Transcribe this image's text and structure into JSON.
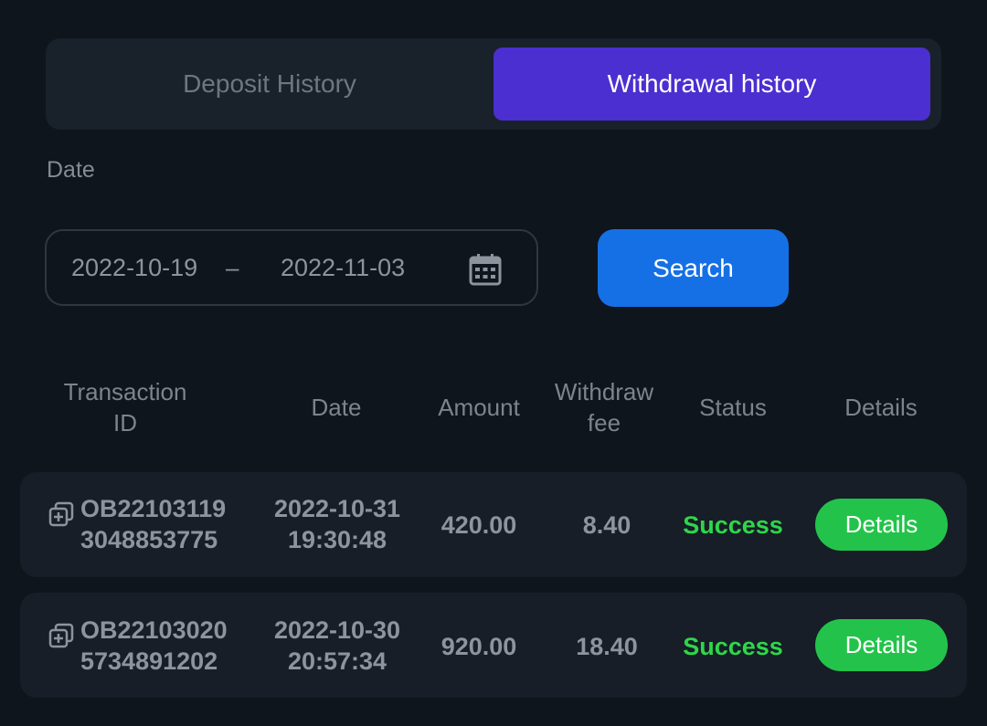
{
  "tabs": {
    "deposit_label": "Deposit History",
    "withdrawal_label": "Withdrawal history",
    "active": "withdrawal"
  },
  "filter": {
    "date_label": "Date",
    "date_from": "2022-10-19",
    "separator": "–",
    "date_to": "2022-11-03",
    "calendar_icon": "calendar-icon",
    "search_label": "Search"
  },
  "table": {
    "headers": {
      "txid_line1": "Transaction",
      "txid_line2": "ID",
      "date": "Date",
      "amount": "Amount",
      "fee_line1": "Withdraw",
      "fee_line2": "fee",
      "status": "Status",
      "details": "Details"
    },
    "rows": [
      {
        "txid_line1": "OB22103119",
        "txid_line2": "3048853775",
        "date_line1": "2022-10-31",
        "date_line2": "19:30:48",
        "amount": "420.00",
        "fee": "8.40",
        "status": "Success",
        "details_label": "Details"
      },
      {
        "txid_line1": "OB22103020",
        "txid_line2": "5734891202",
        "date_line1": "2022-10-30",
        "date_line2": "20:57:34",
        "amount": "920.00",
        "fee": "18.40",
        "status": "Success",
        "details_label": "Details"
      }
    ]
  },
  "colors": {
    "background": "#0f151d",
    "active_tab": "#4b2fd0",
    "search_button": "#1670e5",
    "success": "#2fd64a",
    "details_button": "#23c34b"
  }
}
